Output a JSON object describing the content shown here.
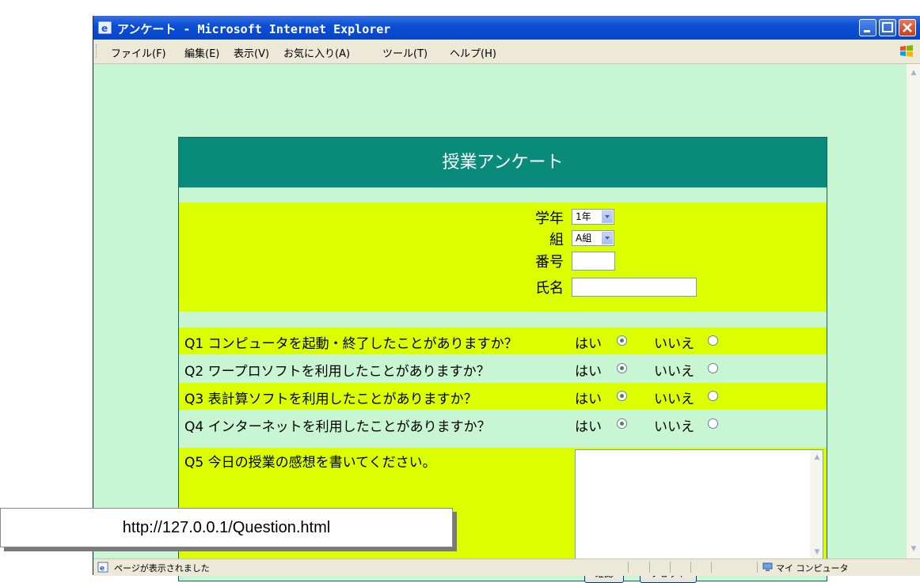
{
  "window": {
    "title": "アンケート - Microsoft Internet Explorer"
  },
  "menubar": {
    "items": [
      "ファイル(F)",
      "編集(E)",
      "表示(V)",
      "お気に入り(A)",
      "ツール(T)",
      "ヘルプ(H)"
    ]
  },
  "form": {
    "header": "授業アンケート",
    "grade_label": "学年",
    "grade_value": "1年",
    "class_label": "組",
    "class_value": "A組",
    "number_label": "番号",
    "number_value": "",
    "name_label": "氏名",
    "name_value": "",
    "questions": [
      {
        "text": "Q1 コンピュータを起動・終了したことがありますか？",
        "yes": "はい",
        "no": "いいえ",
        "selected": "yes"
      },
      {
        "text": "Q2 ワープロソフトを利用したことがありますか？",
        "yes": "はい",
        "no": "いいえ",
        "selected": "yes"
      },
      {
        "text": "Q3 表計算ソフトを利用したことがありますか？",
        "yes": "はい",
        "no": "いいえ",
        "selected": "yes"
      },
      {
        "text": "Q4 インターネットを利用したことがありますか？",
        "yes": "はい",
        "no": "いいえ",
        "selected": "yes"
      }
    ],
    "q5_text": "Q5 今日の授業の感想を書いてください。",
    "q5_value": "",
    "confirm_label": "確認",
    "reset_label": "リセット"
  },
  "statusbar": {
    "text": "ページが表示されました",
    "zone": "マイ コンピュータ"
  },
  "url_caption": "http://127.0.0.1/Question.html"
}
